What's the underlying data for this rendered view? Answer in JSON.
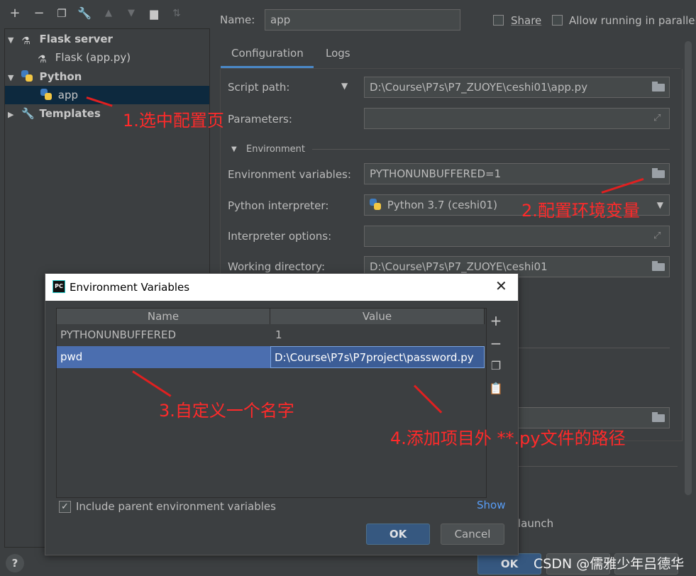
{
  "toolbar": {
    "icons": [
      "add-icon",
      "remove-icon",
      "copy-icon",
      "wrench-icon",
      "move-up-icon",
      "move-down-icon",
      "new-folder-icon",
      "sort-icon"
    ]
  },
  "tree": {
    "flask_server": "Flask server",
    "flask_app": "Flask (app.py)",
    "python": "Python",
    "app": "app",
    "templates": "Templates"
  },
  "name": {
    "label": "Name:",
    "value": "app"
  },
  "share_label": "Share",
  "allow_parallel_label": "Allow running in parallel",
  "tabs": [
    "Configuration",
    "Logs"
  ],
  "config": {
    "script_path_label": "Script path:",
    "script_path_value": "D:\\Course\\P7s\\P7_ZUOYE\\ceshi01\\app.py",
    "parameters_label": "Parameters:",
    "environment_section": "Environment",
    "env_vars_label": "Environment variables:",
    "env_vars_value": "PYTHONUNBUFFERED=1",
    "interpreter_label": "Python interpreter:",
    "interpreter_value": "Python 3.7 (ceshi01)",
    "interp_options_label": "Interpreter options:",
    "working_dir_label": "Working directory:",
    "working_dir_value": "D:\\Course\\P7s\\P7_ZUOYE\\ceshi01",
    "launch_text": "launch"
  },
  "dialog": {
    "title": "Environment Variables",
    "col_name": "Name",
    "col_value": "Value",
    "rows": [
      {
        "name": "PYTHONUNBUFFERED",
        "value": "1"
      },
      {
        "name": "pwd",
        "value": "D:\\Course\\P7s\\P7project\\password.py"
      }
    ],
    "include_parent_label": "Include parent environment variables",
    "show_link": "Show",
    "ok_label": "OK",
    "cancel_label": "Cancel"
  },
  "bottom": {
    "ok_label": "OK",
    "help_icon": "?",
    "watermark": "CSDN @儒雅少年吕德华"
  },
  "annotations": {
    "a1": "1.选中配置页",
    "a2": "2.配置环境变量",
    "a3": "3.自定义一个名字",
    "a4": "4.添加项目外 **.py文件的路径"
  },
  "colors": {
    "accent": "#4b6eaf",
    "selected_tree": "#0d293e",
    "annotation": "#ff2a2a",
    "bg": "#3c3f41"
  }
}
